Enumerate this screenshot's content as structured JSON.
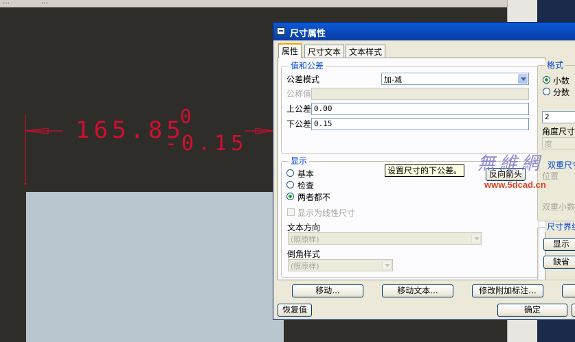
{
  "host": {
    "toolbar_fragment_1": "…",
    "toolbar_fragment_2": "…"
  },
  "drawing": {
    "dimension_value": "165.85",
    "upper_tolerance": "0",
    "lower_tolerance": "-0.15",
    "color": "#d0102e"
  },
  "dialog": {
    "title": "尺寸属性",
    "tabs": [
      "属性",
      "尺寸文本",
      "文本样式"
    ],
    "active_tab": "属性",
    "value_tolerance": {
      "title": "值和公差",
      "tol_mode_label": "公差模式",
      "tol_mode_value": "加-减",
      "nominal_label": "公称值",
      "nominal_value": "",
      "upper_label": "上公差",
      "upper_value": "0.00",
      "lower_label": "下公差",
      "lower_value": "0.15"
    },
    "tooltip": "设置尺寸的下公差。",
    "display": {
      "title": "显示",
      "options": [
        "基本",
        "检查",
        "两者都不"
      ],
      "selected": "两者都不",
      "flip_arrows_button": "反向箭头",
      "show_linear_label": "显示为线性尺寸",
      "text_orientation_label": "文本方向",
      "text_orientation_value": "(照原样)",
      "chamfer_style_label": "倒角样式",
      "chamfer_style_value": "(照原样)"
    },
    "format": {
      "title": "格式",
      "options": [
        "小数",
        "分数"
      ],
      "selected": "小数",
      "decimals_value": "2",
      "angle_label": "角度尺寸",
      "angle_unit_value": "度",
      "dual_dim_label": "双重尺寸",
      "position_label": "位置",
      "dual_decimals_label": "双重小数"
    },
    "witness": {
      "title": "尺寸界线",
      "show_button": "显示",
      "default_button": "缺省"
    },
    "buttons": {
      "move": "移动...",
      "move_text": "移动文本...",
      "edit_attach": "修改附加标注...",
      "restore": "恢复值",
      "ok": "确定"
    }
  },
  "watermark": {
    "text_cn": "無維網",
    "url": "www.5dcad.cn"
  }
}
